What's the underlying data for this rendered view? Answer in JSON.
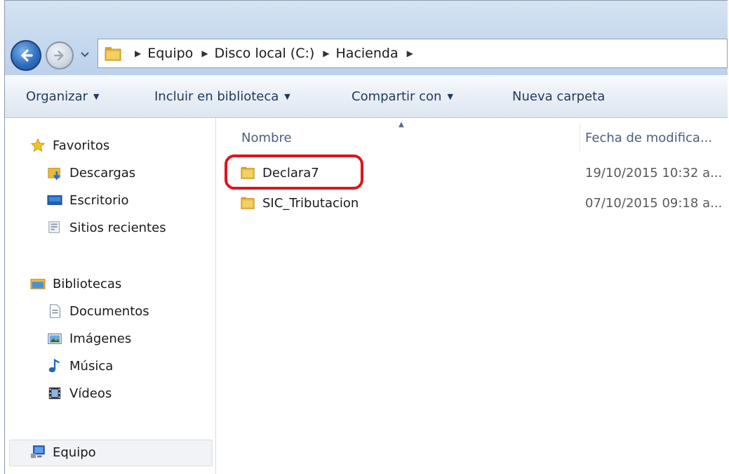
{
  "breadcrumb": {
    "items": [
      "Equipo",
      "Disco local (C:)",
      "Hacienda"
    ]
  },
  "toolbar": {
    "organize": "Organizar",
    "include": "Incluir en biblioteca",
    "share": "Compartir con",
    "new_folder": "Nueva carpeta"
  },
  "nav": {
    "favorites": {
      "label": "Favoritos",
      "items": [
        "Descargas",
        "Escritorio",
        "Sitios recientes"
      ]
    },
    "libraries": {
      "label": "Bibliotecas",
      "items": [
        "Documentos",
        "Imágenes",
        "Música",
        "Vídeos"
      ]
    },
    "computer": {
      "label": "Equipo"
    }
  },
  "columns": {
    "name": "Nombre",
    "date": "Fecha de modifica..."
  },
  "files": [
    {
      "name": "Declara7",
      "date": "19/10/2015 10:32 a...",
      "highlighted": true
    },
    {
      "name": "SIC_Tributacion",
      "date": "07/10/2015 09:18 a...",
      "highlighted": false
    }
  ],
  "colors": {
    "highlight": "#e0141b",
    "folder": "#e8b93a",
    "toolbar_text": "#1e395b"
  }
}
